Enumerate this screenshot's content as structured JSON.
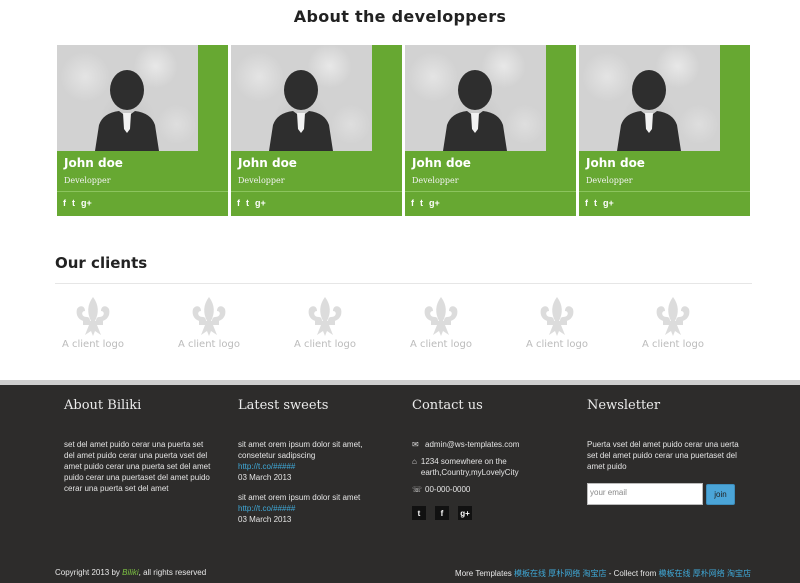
{
  "developers": {
    "title": "About the developpers",
    "cards": [
      {
        "name": "John doe",
        "role": "Developper",
        "social": [
          "f",
          "t",
          "g+"
        ]
      },
      {
        "name": "John doe",
        "role": "Developper",
        "social": [
          "f",
          "t",
          "g+"
        ]
      },
      {
        "name": "John doe",
        "role": "Developper",
        "social": [
          "f",
          "t",
          "g+"
        ]
      },
      {
        "name": "John doe",
        "role": "Developper",
        "social": [
          "f",
          "t",
          "g+"
        ]
      }
    ],
    "card_color": "#67a832"
  },
  "clients": {
    "title": "Our clients",
    "logos": [
      "A client logo",
      "A client logo",
      "A client logo",
      "A client logo",
      "A client logo",
      "A client logo"
    ]
  },
  "footer": {
    "about": {
      "title": "About Biliki",
      "text": "set del amet puido cerar una puerta set del amet puido cerar una puerta vset del amet puido cerar una puerta set del amet puido cerar una puertaset del amet puido cerar una puerta set del amet"
    },
    "tweets": {
      "title": "Latest sweets",
      "items": [
        {
          "text": "sit amet orem ipsum dolor sit amet, consetetur sadipscing",
          "link": "http://t.co/#####",
          "date": "03 March 2013"
        },
        {
          "text": "sit amet orem ipsum dolor sit amet",
          "link": "http://t.co/#####",
          "date": "03 March 2013"
        }
      ]
    },
    "contact": {
      "title": "Contact us",
      "email": "admin@ws-templates.com",
      "address": "1234 somewhere on the earth,Country,myLovelyCity",
      "phone": "00-000-0000",
      "social": [
        "t",
        "f",
        "g+"
      ]
    },
    "newsletter": {
      "title": "Newsletter",
      "text": "Puerta vset del amet puido cerar una uerta set del amet puido cerar una puertaset del amet puido",
      "placeholder": "your email",
      "button": "join"
    },
    "copyright_prefix": "Copyright 2013 by",
    "copyright_brand": "Biliki",
    "copyright_suffix": ", all rights reserved",
    "more_prefix": "More Templates",
    "more_link1": "模板在线",
    "more_link2": "厚朴网络",
    "more_link3": "淘宝店",
    "collect_prefix": "- Collect from",
    "collect_link1": "模板在线",
    "collect_link2": "厚朴网络",
    "collect_link3": "淘宝店"
  }
}
